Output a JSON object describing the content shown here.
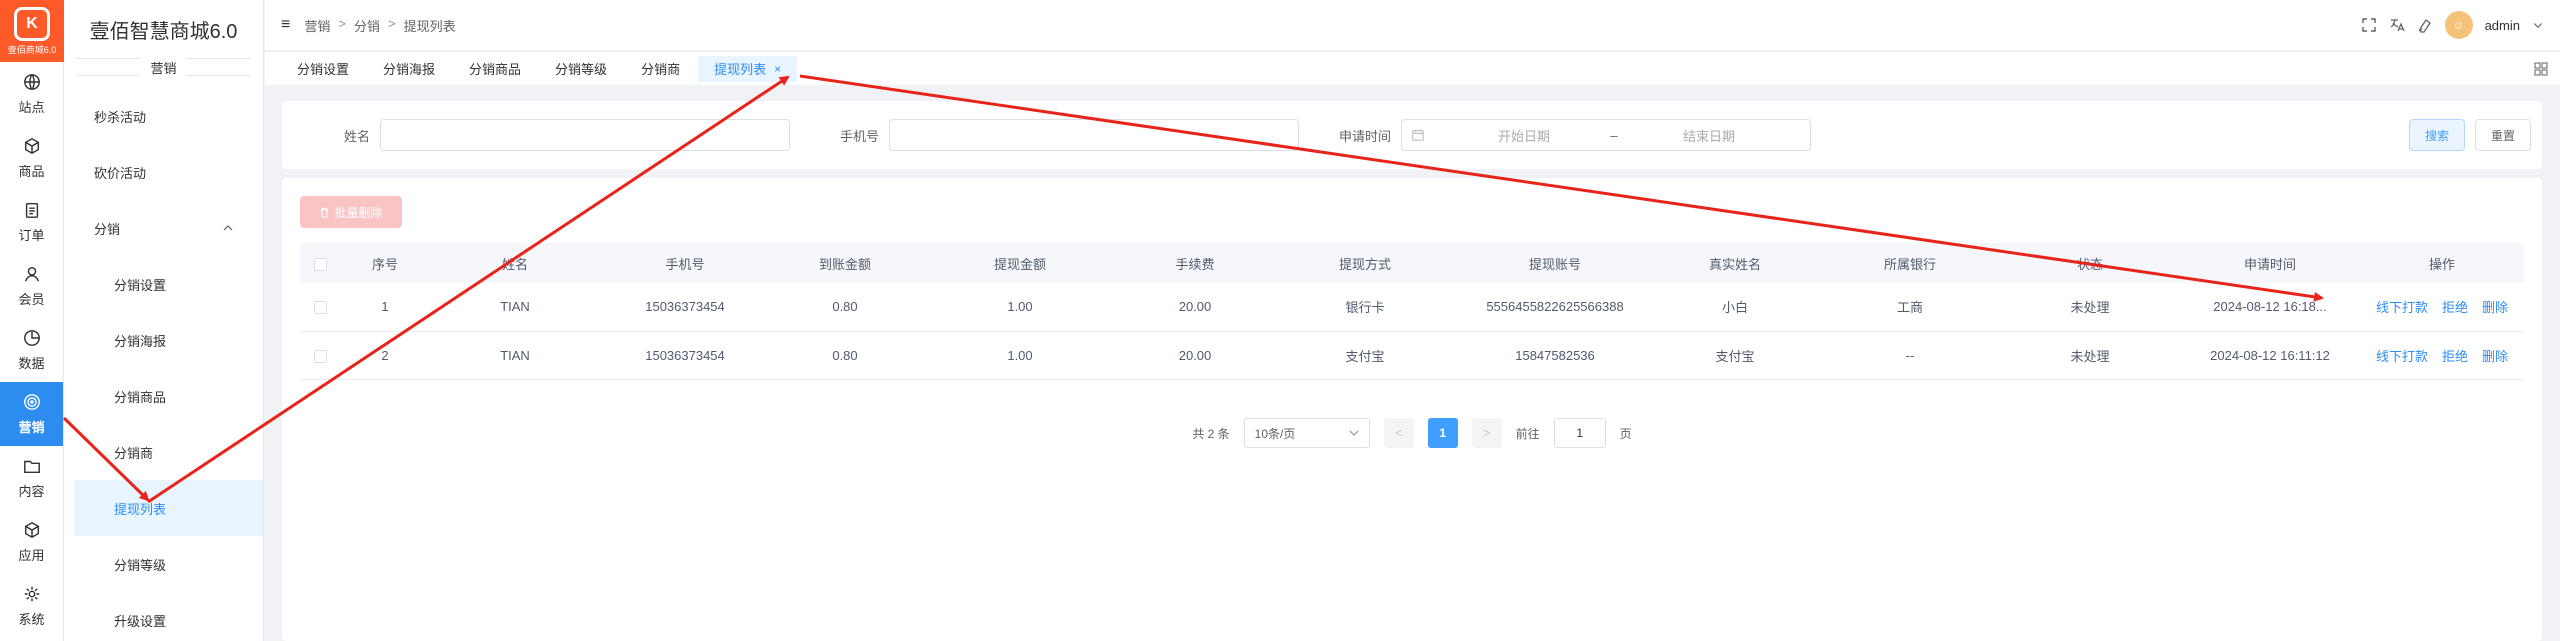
{
  "logo": {
    "mark": "K",
    "sub": "壹佰商城6.0"
  },
  "rail": [
    {
      "label": "站点",
      "icon": "globe-icon"
    },
    {
      "label": "商品",
      "icon": "box-icon"
    },
    {
      "label": "订单",
      "icon": "clipboard-icon"
    },
    {
      "label": "会员",
      "icon": "user-icon"
    },
    {
      "label": "数据",
      "icon": "pie-chart-icon"
    },
    {
      "label": "营销",
      "icon": "target-icon",
      "active": true
    },
    {
      "label": "内容",
      "icon": "folder-icon"
    },
    {
      "label": "应用",
      "icon": "cube-icon"
    },
    {
      "label": "系统",
      "icon": "gear-icon"
    }
  ],
  "submenu": {
    "brand": "壹佰智慧商城6.0",
    "section": "营销",
    "items": [
      {
        "label": "秒杀活动"
      },
      {
        "label": "砍价活动"
      },
      {
        "label": "分销"
      },
      {
        "label": "分销设置"
      },
      {
        "label": "分销海报"
      },
      {
        "label": "分销商品"
      },
      {
        "label": "分销商"
      },
      {
        "label": "提现列表"
      },
      {
        "label": "分销等级"
      },
      {
        "label": "升级设置"
      }
    ]
  },
  "header": {
    "breadcrumb": [
      "营销",
      ">",
      "分销",
      ">",
      "提现列表"
    ],
    "user": "admin"
  },
  "tabs": [
    {
      "label": "分销设置"
    },
    {
      "label": "分销海报"
    },
    {
      "label": "分销商品"
    },
    {
      "label": "分销等级"
    },
    {
      "label": "分销商"
    },
    {
      "label": "提现列表",
      "close": "×"
    }
  ],
  "search": {
    "name_label": "姓名",
    "phone_label": "手机号",
    "time_label": "申请时间",
    "start_placeholder": "开始日期",
    "range_sep": "–",
    "end_placeholder": "结束日期",
    "search_btn": "搜索",
    "reset_btn": "重置"
  },
  "batch_delete": "批量删除",
  "table": {
    "columns": [
      "序号",
      "姓名",
      "手机号",
      "到账金额",
      "提现金额",
      "手续费",
      "提现方式",
      "提现账号",
      "真实姓名",
      "所属银行",
      "状态",
      "申请时间",
      "操作"
    ],
    "rows": [
      {
        "idx": "1",
        "name": "TIAN",
        "phone": "15036373454",
        "arrive": "0.80",
        "amount": "1.00",
        "fee": "20.00",
        "method": "银行卡",
        "account": "5556455822625566388",
        "realname": "小白",
        "bank": "工商",
        "status": "未处理",
        "time": "2024-08-12 16:18...",
        "op1": "线下打款",
        "op2": "拒绝",
        "op3": "删除"
      },
      {
        "idx": "2",
        "name": "TIAN",
        "phone": "15036373454",
        "arrive": "0.80",
        "amount": "1.00",
        "fee": "20.00",
        "method": "支付宝",
        "account": "15847582536",
        "realname": "支付宝",
        "bank": "--",
        "status": "未处理",
        "time": "2024-08-12 16:11:12",
        "op1": "线下打款",
        "op2": "拒绝",
        "op3": "删除"
      }
    ]
  },
  "pager": {
    "total": "共 2 条",
    "page_size": "10条/页",
    "prev": "<",
    "current": "1",
    "next": ">",
    "goto": "前往",
    "goto_value": "1",
    "page_suffix": "页"
  },
  "colors": {
    "primary": "#2d8cf0",
    "logo": "#ff5a2a",
    "annotation": "#e8241a"
  }
}
